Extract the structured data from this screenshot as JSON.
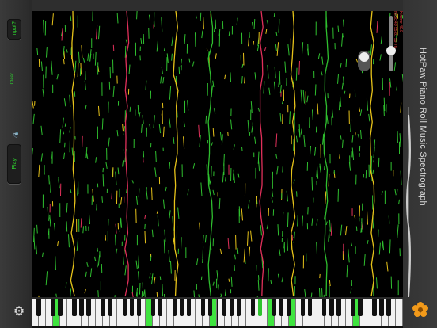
{
  "app": {
    "title": "HotPaw Piano Roll Music Spectrograph"
  },
  "sidebar": {
    "input_label": "Input?",
    "clear_label": "Clear",
    "play_label": "Play"
  },
  "status": {
    "lines": [
      "Kinemr 49.9",
      "midic 49 55 81 59 76"
    ]
  },
  "keyboard": {
    "white_keys": 52,
    "active_white": [
      3,
      16,
      25,
      33,
      36,
      45
    ],
    "active_black": [
      22
    ]
  },
  "colors": {
    "note_green": "#2fbf2f",
    "note_yellow": "#e6c21a",
    "note_red": "#e0305a",
    "accent": "#2fd42f"
  },
  "icons": [
    "settings-gear-icon",
    "speaker-icon",
    "flower-logo-icon"
  ]
}
